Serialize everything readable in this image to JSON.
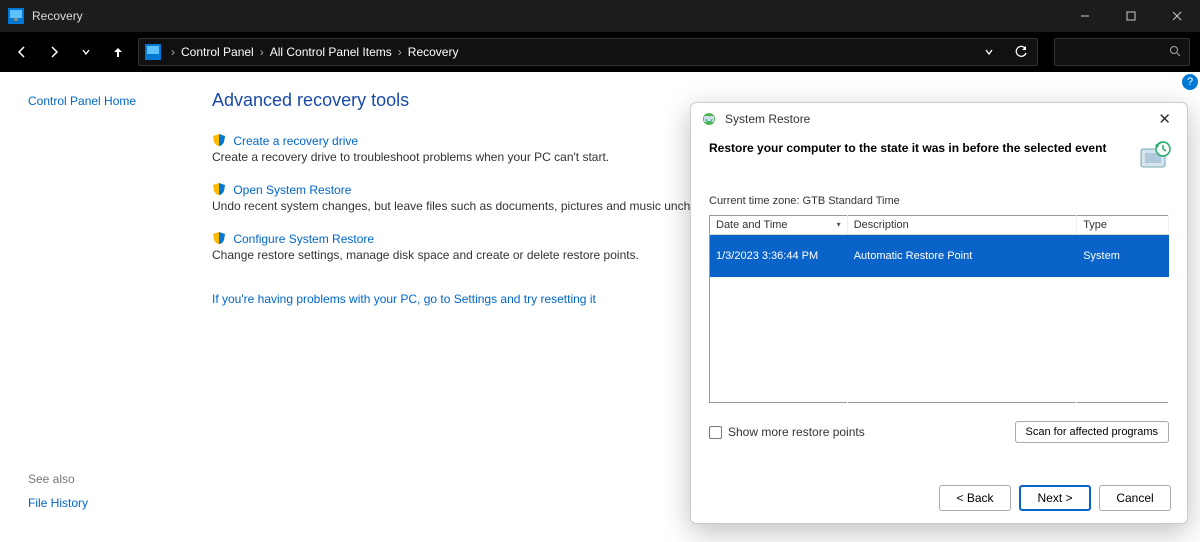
{
  "window": {
    "title": "Recovery"
  },
  "breadcrumbs": {
    "items": [
      "Control Panel",
      "All Control Panel Items",
      "Recovery"
    ]
  },
  "sidebar": {
    "home": "Control Panel Home",
    "seealso_header": "See also",
    "seealso_items": [
      "File History"
    ]
  },
  "main": {
    "heading": "Advanced recovery tools",
    "tools": [
      {
        "link": "Create a recovery drive",
        "desc": "Create a recovery drive to troubleshoot problems when your PC can't start."
      },
      {
        "link": "Open System Restore",
        "desc": "Undo recent system changes, but leave files such as documents, pictures and music unchanged."
      },
      {
        "link": "Configure System Restore",
        "desc": "Change restore settings, manage disk space and create or delete restore points."
      }
    ],
    "reset_link": "If you're having problems with your PC, go to Settings and try resetting it"
  },
  "dialog": {
    "title": "System Restore",
    "heading": "Restore your computer to the state it was in before the selected event",
    "timezone_line": "Current time zone: GTB Standard Time",
    "columns": {
      "date": "Date and Time",
      "desc": "Description",
      "type": "Type"
    },
    "rows": [
      {
        "date": "1/3/2023 3:36:44 PM",
        "desc": "Automatic Restore Point",
        "type": "System"
      }
    ],
    "show_more": "Show more restore points",
    "scan_btn": "Scan for affected programs",
    "buttons": {
      "back": "< Back",
      "next": "Next >",
      "cancel": "Cancel"
    }
  },
  "help_tooltip": "?"
}
